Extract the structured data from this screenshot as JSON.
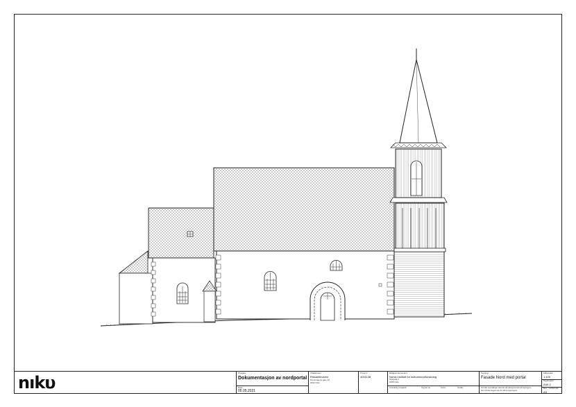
{
  "logo": {
    "text": "nıkυ"
  },
  "title_block": {
    "prosjekt_label": "Prosjekt:",
    "prosjekt_value": "Dokumentasjon av nordportal",
    "dato_label": "Dato:",
    "dato_value": "05.05.2021",
    "tiltakshaver_label": "Tiltakshaver:",
    "tiltakshaver_value": "Riksantikvaren",
    "tiltakshaver_addr1": "Dronningens gate 13",
    "tiltakshaver_addr2": "0152 Oslo",
    "prosjektnr_label": "Prosj.nr.:",
    "prosjektnr_value": "4001138",
    "konsulent_label": "Rådgiver/konsulent:",
    "konsulent_value": "Norsk institutt for kulturminneforskning",
    "konsulent_addr1": "Storgata 2",
    "konsulent_addr2": "0155 Oslo",
    "ansvarlig_label": "Ansvarlig prosjektl.:",
    "tegnet_label": "Tegnet av:",
    "kontr_label": "Kontr.:",
    "godkj_label": "Godkj.:",
    "tegning_label": "Tegning:",
    "tegning_value": "Fasade Nord med portal",
    "note_line1": "Ved alle oppmålinger skal det stå tydelig kontroll på tegningene.",
    "note_line2": "Det må ikke legges opp til mål fra tegningene.",
    "malestokk_label": "Målestokk:",
    "malestokk_value": "1:100",
    "tegningsnr_label": "Tegningsnr.:",
    "tegningsnr_value": "A40-2",
    "format_label": "Rev. / Arkformat:",
    "format_value": "A3"
  }
}
